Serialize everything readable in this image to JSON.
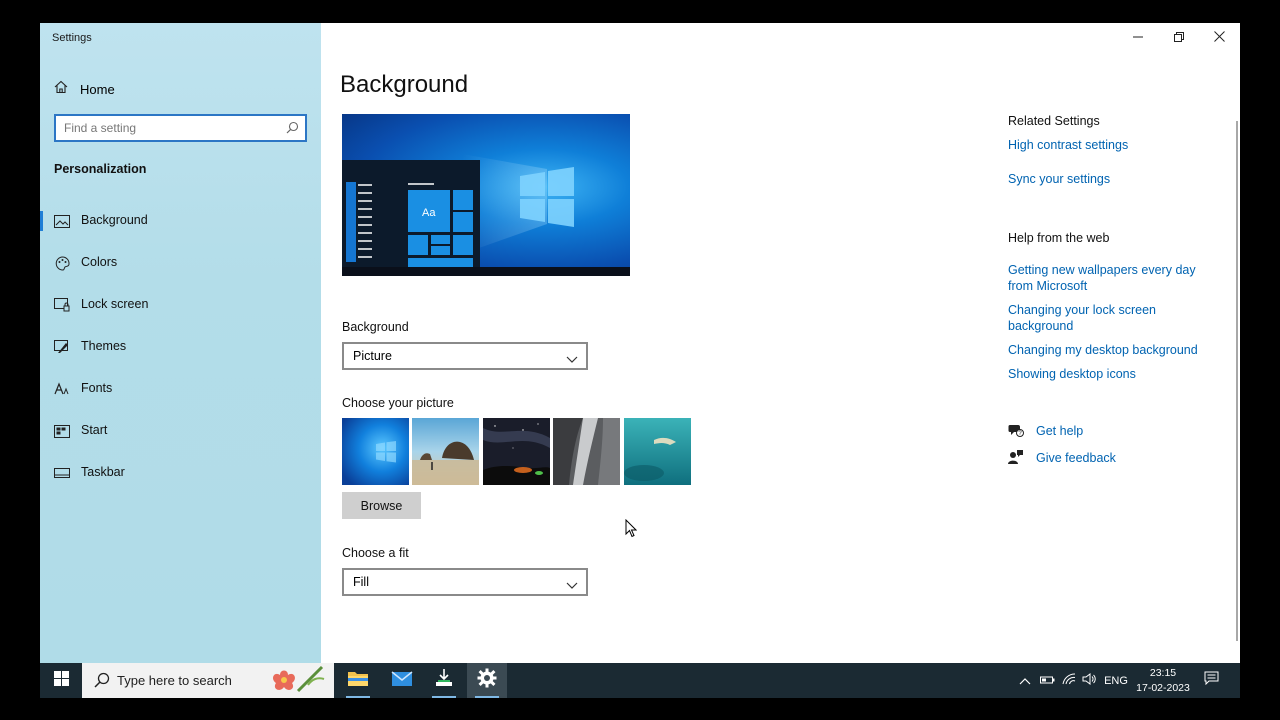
{
  "window": {
    "title": "Settings"
  },
  "sidebar": {
    "home_label": "Home",
    "search_placeholder": "Find a setting",
    "section_title": "Personalization",
    "items": [
      {
        "label": "Background",
        "icon": "picture-icon",
        "active": true
      },
      {
        "label": "Colors",
        "icon": "palette-icon"
      },
      {
        "label": "Lock screen",
        "icon": "lock-screen-icon"
      },
      {
        "label": "Themes",
        "icon": "themes-icon"
      },
      {
        "label": "Fonts",
        "icon": "fonts-icon"
      },
      {
        "label": "Start",
        "icon": "start-icon"
      },
      {
        "label": "Taskbar",
        "icon": "taskbar-icon"
      }
    ]
  },
  "main": {
    "title": "Background",
    "preview_sample_text": "Aa",
    "background_label": "Background",
    "background_value": "Picture",
    "choose_picture_label": "Choose your picture",
    "browse_label": "Browse",
    "fit_label": "Choose a fit",
    "fit_value": "Fill"
  },
  "related": {
    "heading": "Related Settings",
    "links": [
      "High contrast settings",
      "Sync your settings"
    ],
    "help_heading": "Help from the web",
    "help_links": [
      "Getting new wallpapers every day from Microsoft",
      "Changing your lock screen background",
      "Changing my desktop background",
      "Showing desktop icons"
    ],
    "get_help": "Get help",
    "give_feedback": "Give feedback"
  },
  "taskbar": {
    "search_text": "Type here to search",
    "language": "ENG",
    "time": "23:15",
    "date": "17-02-2023"
  },
  "colors": {
    "accent": "#0078d7",
    "link": "#0063b1",
    "taskbar": "#1b2a33",
    "sidebar": "#b3dde9"
  }
}
